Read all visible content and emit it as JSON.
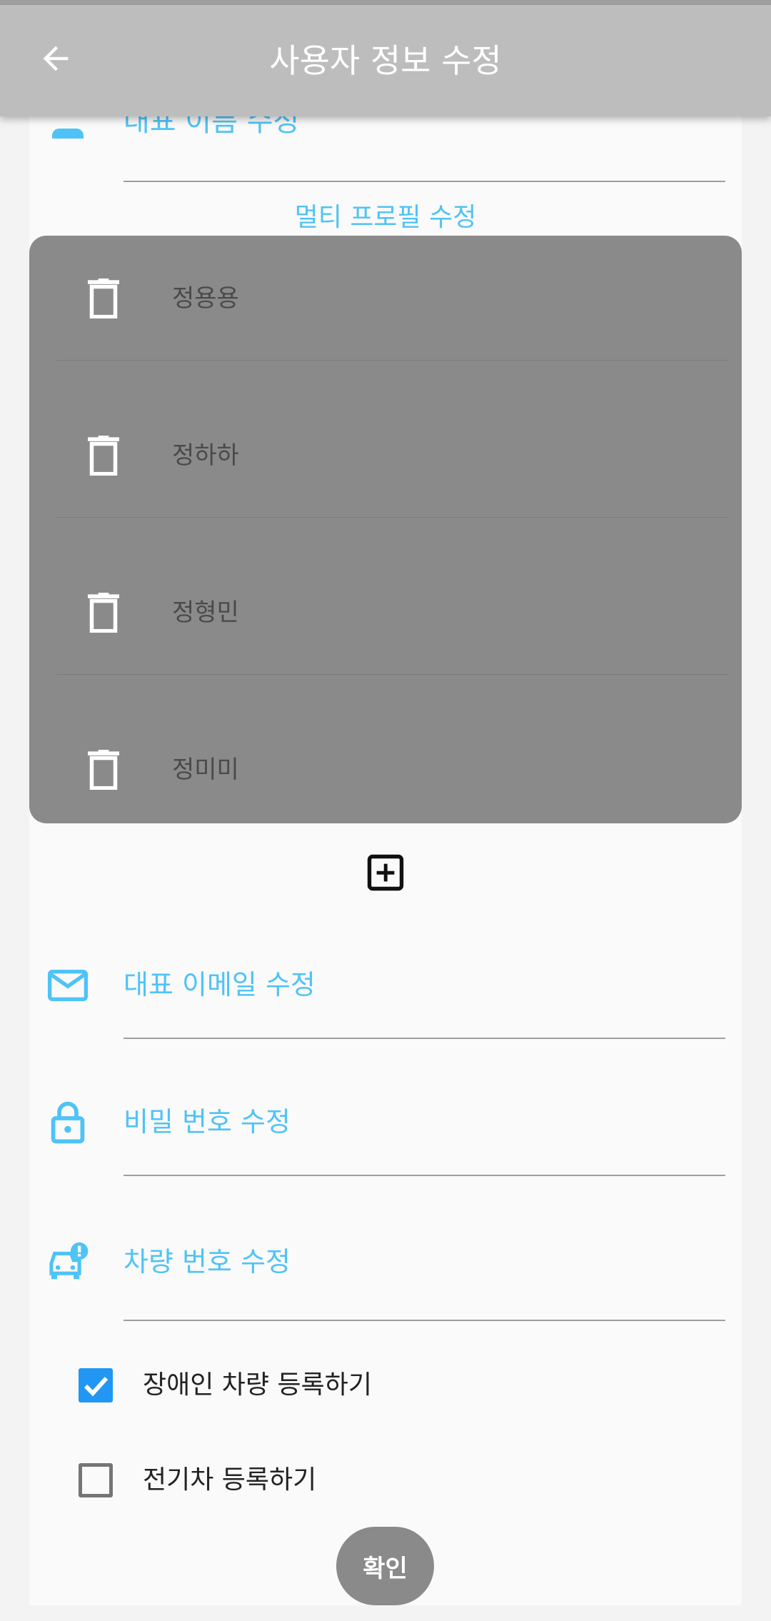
{
  "header": {
    "title": "사용자 정보 수정"
  },
  "partial_field": {
    "label": "대표 이름 수정"
  },
  "multi_profile": {
    "title": "멀티 프로필 수정",
    "profiles": [
      {
        "name": "정용용"
      },
      {
        "name": "정하하"
      },
      {
        "name": "정형민"
      },
      {
        "name": "정미미"
      }
    ]
  },
  "fields": {
    "email_label": "대표 이메일 수정",
    "password_label": "비밀 번호 수정",
    "car_label": "차량 번호 수정"
  },
  "options": {
    "disabled_car_label": "장애인 차량 등록하기",
    "disabled_car_checked": true,
    "ev_label": "전기차 등록하기",
    "ev_checked": false
  },
  "confirm_label": "확인",
  "colors": {
    "accent": "#4fc3f7",
    "appbar": "#bdbdbd",
    "card": "#8a8a8a",
    "checkbox": "#2196f3"
  }
}
